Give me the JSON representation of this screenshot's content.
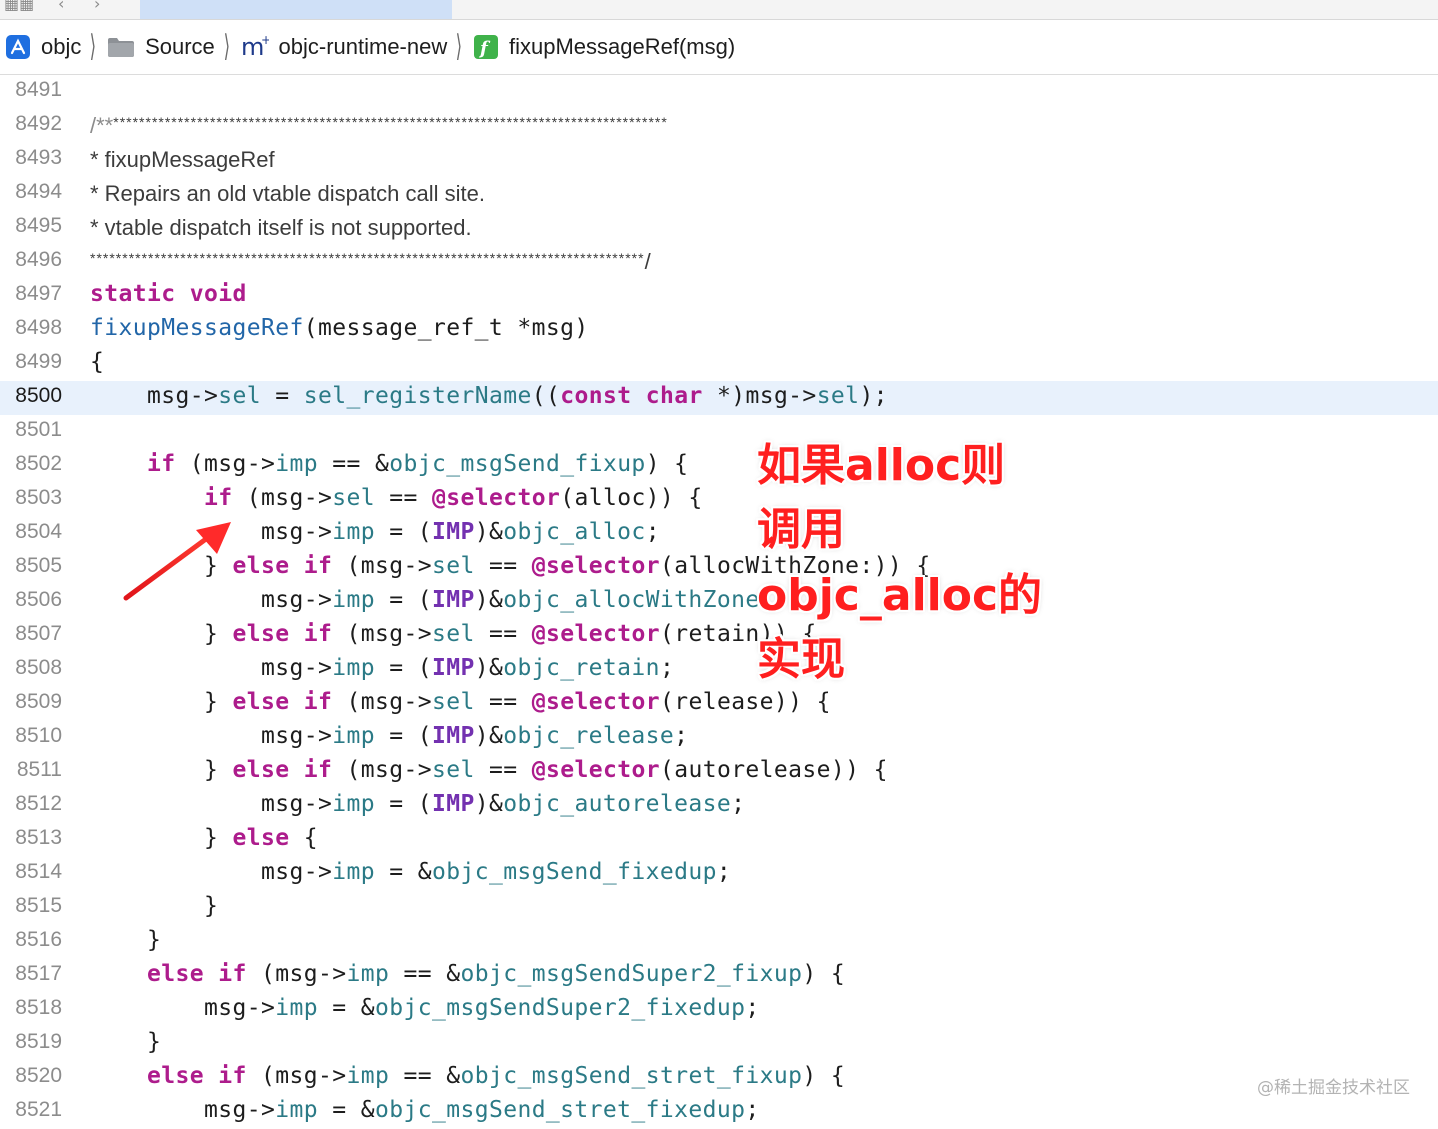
{
  "breadcrumb": [
    {
      "label": "objc",
      "icon": "app-project-icon"
    },
    {
      "label": "Source",
      "icon": "folder-icon"
    },
    {
      "label": "objc-runtime-new",
      "icon": "objc-impl-file-icon"
    },
    {
      "label": "fixupMessageRef(msg)",
      "icon": "function-icon"
    }
  ],
  "current_line": "8500",
  "lines": [
    {
      "num": "8491",
      "tokens": []
    },
    {
      "num": "8492",
      "kind": "comment",
      "tokens": [
        {
          "t": "/**",
          "c": "cmt"
        },
        {
          "t": "**************************************************************************************",
          "c": "stars"
        }
      ]
    },
    {
      "num": "8493",
      "kind": "comment",
      "tokens": [
        {
          "t": "* fixupMessageRef",
          "c": ""
        }
      ]
    },
    {
      "num": "8494",
      "kind": "comment",
      "tokens": [
        {
          "t": "* Repairs an old vtable dispatch call site.",
          "c": ""
        }
      ]
    },
    {
      "num": "8495",
      "kind": "comment",
      "tokens": [
        {
          "t": "* vtable dispatch itself is not supported.",
          "c": ""
        }
      ]
    },
    {
      "num": "8496",
      "kind": "comment",
      "tokens": [
        {
          "t": "**************************************************************************************",
          "c": "stars"
        },
        {
          "t": "/",
          "c": ""
        }
      ]
    },
    {
      "num": "8497",
      "tokens": [
        {
          "t": "static",
          "c": "kw"
        },
        {
          "t": " ",
          "c": ""
        },
        {
          "t": "void",
          "c": "kw"
        }
      ]
    },
    {
      "num": "8498",
      "tokens": [
        {
          "t": "fixupMessageRef",
          "c": "fn"
        },
        {
          "t": "(message_ref_t *msg)",
          "c": ""
        }
      ]
    },
    {
      "num": "8499",
      "tokens": [
        {
          "t": "{",
          "c": ""
        }
      ]
    },
    {
      "num": "8500",
      "tokens": [
        {
          "t": "    msg->",
          "c": ""
        },
        {
          "t": "sel",
          "c": "pr"
        },
        {
          "t": " = ",
          "c": ""
        },
        {
          "t": "sel_registerName",
          "c": "pr"
        },
        {
          "t": "((",
          "c": ""
        },
        {
          "t": "const",
          "c": "kw"
        },
        {
          "t": " ",
          "c": ""
        },
        {
          "t": "char",
          "c": "kw"
        },
        {
          "t": " *)msg->",
          "c": ""
        },
        {
          "t": "sel",
          "c": "pr"
        },
        {
          "t": ");",
          "c": ""
        }
      ]
    },
    {
      "num": "8501",
      "tokens": []
    },
    {
      "num": "8502",
      "tokens": [
        {
          "t": "    ",
          "c": ""
        },
        {
          "t": "if",
          "c": "kw"
        },
        {
          "t": " (msg->",
          "c": ""
        },
        {
          "t": "imp",
          "c": "pr"
        },
        {
          "t": " == &",
          "c": ""
        },
        {
          "t": "objc_msgSend_fixup",
          "c": "pr"
        },
        {
          "t": ") {",
          "c": ""
        }
      ]
    },
    {
      "num": "8503",
      "tokens": [
        {
          "t": "        ",
          "c": ""
        },
        {
          "t": "if",
          "c": "kw"
        },
        {
          "t": " (msg->",
          "c": ""
        },
        {
          "t": "sel",
          "c": "pr"
        },
        {
          "t": " == ",
          "c": ""
        },
        {
          "t": "@selector",
          "c": "kw"
        },
        {
          "t": "(alloc)) {",
          "c": ""
        }
      ]
    },
    {
      "num": "8504",
      "tokens": [
        {
          "t": "            msg->",
          "c": ""
        },
        {
          "t": "imp",
          "c": "pr"
        },
        {
          "t": " = (",
          "c": ""
        },
        {
          "t": "IMP",
          "c": "ty"
        },
        {
          "t": ")&",
          "c": ""
        },
        {
          "t": "objc_alloc",
          "c": "pr"
        },
        {
          "t": ";",
          "c": ""
        }
      ]
    },
    {
      "num": "8505",
      "tokens": [
        {
          "t": "        } ",
          "c": ""
        },
        {
          "t": "else",
          "c": "kw"
        },
        {
          "t": " ",
          "c": ""
        },
        {
          "t": "if",
          "c": "kw"
        },
        {
          "t": " (msg->",
          "c": ""
        },
        {
          "t": "sel",
          "c": "pr"
        },
        {
          "t": " == ",
          "c": ""
        },
        {
          "t": "@selector",
          "c": "kw"
        },
        {
          "t": "(allocWithZone:)) {",
          "c": ""
        }
      ]
    },
    {
      "num": "8506",
      "tokens": [
        {
          "t": "            msg->",
          "c": ""
        },
        {
          "t": "imp",
          "c": "pr"
        },
        {
          "t": " = (",
          "c": ""
        },
        {
          "t": "IMP",
          "c": "ty"
        },
        {
          "t": ")&",
          "c": ""
        },
        {
          "t": "objc_allocWithZone",
          "c": "pr"
        },
        {
          "t": ";",
          "c": ""
        }
      ]
    },
    {
      "num": "8507",
      "tokens": [
        {
          "t": "        } ",
          "c": ""
        },
        {
          "t": "else",
          "c": "kw"
        },
        {
          "t": " ",
          "c": ""
        },
        {
          "t": "if",
          "c": "kw"
        },
        {
          "t": " (msg->",
          "c": ""
        },
        {
          "t": "sel",
          "c": "pr"
        },
        {
          "t": " == ",
          "c": ""
        },
        {
          "t": "@selector",
          "c": "kw"
        },
        {
          "t": "(retain)) {",
          "c": ""
        }
      ]
    },
    {
      "num": "8508",
      "tokens": [
        {
          "t": "            msg->",
          "c": ""
        },
        {
          "t": "imp",
          "c": "pr"
        },
        {
          "t": " = (",
          "c": ""
        },
        {
          "t": "IMP",
          "c": "ty"
        },
        {
          "t": ")&",
          "c": ""
        },
        {
          "t": "objc_retain",
          "c": "pr"
        },
        {
          "t": ";",
          "c": ""
        }
      ]
    },
    {
      "num": "8509",
      "tokens": [
        {
          "t": "        } ",
          "c": ""
        },
        {
          "t": "else",
          "c": "kw"
        },
        {
          "t": " ",
          "c": ""
        },
        {
          "t": "if",
          "c": "kw"
        },
        {
          "t": " (msg->",
          "c": ""
        },
        {
          "t": "sel",
          "c": "pr"
        },
        {
          "t": " == ",
          "c": ""
        },
        {
          "t": "@selector",
          "c": "kw"
        },
        {
          "t": "(release)) {",
          "c": ""
        }
      ]
    },
    {
      "num": "8510",
      "tokens": [
        {
          "t": "            msg->",
          "c": ""
        },
        {
          "t": "imp",
          "c": "pr"
        },
        {
          "t": " = (",
          "c": ""
        },
        {
          "t": "IMP",
          "c": "ty"
        },
        {
          "t": ")&",
          "c": ""
        },
        {
          "t": "objc_release",
          "c": "pr"
        },
        {
          "t": ";",
          "c": ""
        }
      ]
    },
    {
      "num": "8511",
      "tokens": [
        {
          "t": "        } ",
          "c": ""
        },
        {
          "t": "else",
          "c": "kw"
        },
        {
          "t": " ",
          "c": ""
        },
        {
          "t": "if",
          "c": "kw"
        },
        {
          "t": " (msg->",
          "c": ""
        },
        {
          "t": "sel",
          "c": "pr"
        },
        {
          "t": " == ",
          "c": ""
        },
        {
          "t": "@selector",
          "c": "kw"
        },
        {
          "t": "(autorelease)) {",
          "c": ""
        }
      ]
    },
    {
      "num": "8512",
      "tokens": [
        {
          "t": "            msg->",
          "c": ""
        },
        {
          "t": "imp",
          "c": "pr"
        },
        {
          "t": " = (",
          "c": ""
        },
        {
          "t": "IMP",
          "c": "ty"
        },
        {
          "t": ")&",
          "c": ""
        },
        {
          "t": "objc_autorelease",
          "c": "pr"
        },
        {
          "t": ";",
          "c": ""
        }
      ]
    },
    {
      "num": "8513",
      "tokens": [
        {
          "t": "        } ",
          "c": ""
        },
        {
          "t": "else",
          "c": "kw"
        },
        {
          "t": " {",
          "c": ""
        }
      ]
    },
    {
      "num": "8514",
      "tokens": [
        {
          "t": "            msg->",
          "c": ""
        },
        {
          "t": "imp",
          "c": "pr"
        },
        {
          "t": " = &",
          "c": ""
        },
        {
          "t": "objc_msgSend_fixedup",
          "c": "pr"
        },
        {
          "t": ";",
          "c": ""
        }
      ]
    },
    {
      "num": "8515",
      "tokens": [
        {
          "t": "        }",
          "c": ""
        }
      ]
    },
    {
      "num": "8516",
      "tokens": [
        {
          "t": "    }",
          "c": ""
        }
      ]
    },
    {
      "num": "8517",
      "tokens": [
        {
          "t": "    ",
          "c": ""
        },
        {
          "t": "else",
          "c": "kw"
        },
        {
          "t": " ",
          "c": ""
        },
        {
          "t": "if",
          "c": "kw"
        },
        {
          "t": " (msg->",
          "c": ""
        },
        {
          "t": "imp",
          "c": "pr"
        },
        {
          "t": " == &",
          "c": ""
        },
        {
          "t": "objc_msgSendSuper2_fixup",
          "c": "pr"
        },
        {
          "t": ") {",
          "c": ""
        }
      ]
    },
    {
      "num": "8518",
      "tokens": [
        {
          "t": "        msg->",
          "c": ""
        },
        {
          "t": "imp",
          "c": "pr"
        },
        {
          "t": " = &",
          "c": ""
        },
        {
          "t": "objc_msgSendSuper2_fixedup",
          "c": "pr"
        },
        {
          "t": ";",
          "c": ""
        }
      ]
    },
    {
      "num": "8519",
      "tokens": [
        {
          "t": "    }",
          "c": ""
        }
      ]
    },
    {
      "num": "8520",
      "tokens": [
        {
          "t": "    ",
          "c": ""
        },
        {
          "t": "else",
          "c": "kw"
        },
        {
          "t": " ",
          "c": ""
        },
        {
          "t": "if",
          "c": "kw"
        },
        {
          "t": " (msg->",
          "c": ""
        },
        {
          "t": "imp",
          "c": "pr"
        },
        {
          "t": " == &",
          "c": ""
        },
        {
          "t": "objc_msgSend_stret_fixup",
          "c": "pr"
        },
        {
          "t": ") {",
          "c": ""
        }
      ]
    },
    {
      "num": "8521",
      "tokens": [
        {
          "t": "        msg->",
          "c": ""
        },
        {
          "t": "imp",
          "c": "pr"
        },
        {
          "t": " = &",
          "c": ""
        },
        {
          "t": "objc_msgSend_stret_fixedup",
          "c": "pr"
        },
        {
          "t": ";",
          "c": ""
        }
      ]
    }
  ],
  "annotation": {
    "lines": [
      "如果alloc则",
      "调用",
      "objc_alloc的",
      "实现"
    ],
    "color": "#ff1f1f"
  },
  "watermark": "@稀土掘金技术社区",
  "colors": {
    "keyword": "#ad1c8c",
    "function": "#2266a8",
    "property": "#2b7a86",
    "type": "#7331b0",
    "highlight": "#e8f1fc"
  }
}
